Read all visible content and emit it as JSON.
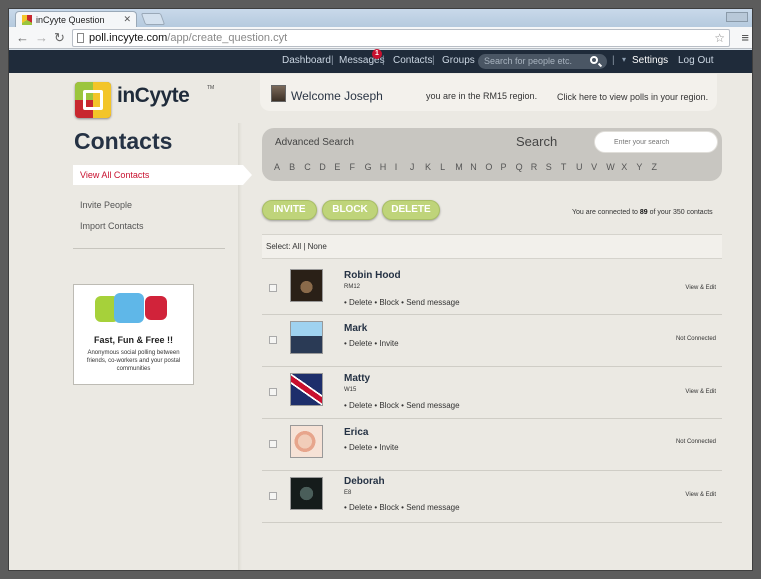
{
  "browser": {
    "tab_title": "inCyyte Question",
    "url_host": "poll.incyyte.com",
    "url_path": "/app/create_question.cyt"
  },
  "topnav": {
    "dashboard": "Dashboard",
    "messages": "Messages",
    "messages_badge": "1",
    "contacts": "Contacts",
    "groups": "Groups",
    "search_placeholder": "Search for people etc.",
    "settings": "Settings",
    "logout": "Log Out"
  },
  "brand": {
    "name": "inCyyte",
    "tm": "TM"
  },
  "welcome": {
    "greeting": "Welcome Joseph",
    "region": "you are in the RM15 region.",
    "region_link": "Click here to view polls in your region."
  },
  "page_title": "Contacts",
  "sidebar": {
    "items": [
      "View All Contacts",
      "Invite People",
      "Import Contacts"
    ]
  },
  "promo": {
    "title": "Fast, Fun & Free !!",
    "subtitle": "Anonymous social polling between friends, co-workers and your postal communities"
  },
  "search": {
    "advanced": "Advanced Search",
    "label": "Search",
    "placeholder": "Enter your search",
    "letters": [
      "A",
      "B",
      "C",
      "D",
      "E",
      "F",
      "G",
      "H",
      "I",
      "J",
      "K",
      "L",
      "M",
      "N",
      "O",
      "P",
      "Q",
      "R",
      "S",
      "T",
      "U",
      "V",
      "W",
      "X",
      "Y",
      "Z"
    ]
  },
  "actions": {
    "invite": "INVITE",
    "block": "BLOCK",
    "delete": "DELETE"
  },
  "connected": {
    "prefix": "You are connected to",
    "count": "89",
    "suffix": "of your 350 contacts"
  },
  "select_row": "Select: All | None",
  "contacts": [
    {
      "name": "Robin Hood",
      "region": "RM12",
      "actions": "• Delete • Block • Send message",
      "status": "View & Edit"
    },
    {
      "name": "Mark",
      "region": "",
      "actions": "• Delete • Invite",
      "status": "Not Connected"
    },
    {
      "name": "Matty",
      "region": "W15",
      "actions": "• Delete • Block • Send message",
      "status": "View & Edit"
    },
    {
      "name": "Erica",
      "region": "",
      "actions": "• Delete • Invite",
      "status": "Not Connected"
    },
    {
      "name": "Deborah",
      "region": "E8",
      "actions": "• Delete • Block • Send message",
      "status": "View & Edit"
    }
  ],
  "colors": {
    "navbar": "#1f2b3a",
    "accent_red": "#c8102e",
    "button_green": "#bfd47a",
    "title_navy": "#253244"
  }
}
